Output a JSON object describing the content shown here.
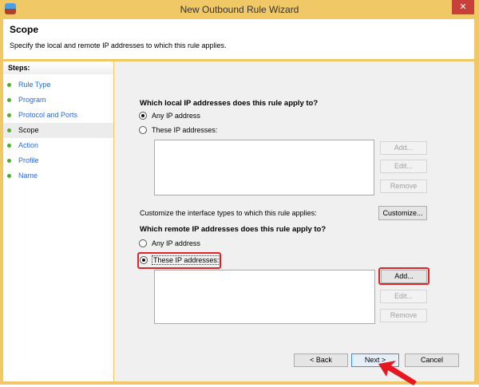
{
  "window": {
    "title": "New Outbound Rule Wizard",
    "close": "✕"
  },
  "header": {
    "title": "Scope",
    "subtitle": "Specify the local and remote IP addresses to which this rule applies."
  },
  "steps": {
    "heading": "Steps:",
    "items": [
      "Rule Type",
      "Program",
      "Protocol and Ports",
      "Scope",
      "Action",
      "Profile",
      "Name"
    ],
    "current": "Scope"
  },
  "local": {
    "question": "Which local IP addresses does this rule apply to?",
    "any": "Any IP address",
    "these": "These IP addresses:",
    "selected": "any",
    "add": "Add...",
    "edit": "Edit...",
    "remove": "Remove"
  },
  "customize": {
    "text": "Customize the interface types to which this rule applies:",
    "button": "Customize..."
  },
  "remote": {
    "question": "Which remote IP addresses does this rule apply to?",
    "any": "Any IP address",
    "these": "These IP addresses:",
    "selected": "these",
    "add": "Add...",
    "edit": "Edit...",
    "remove": "Remove"
  },
  "footer": {
    "back": "< Back",
    "next": "Next >",
    "cancel": "Cancel"
  },
  "colors": {
    "highlight": "#e0242c",
    "frame": "#F0C865"
  }
}
